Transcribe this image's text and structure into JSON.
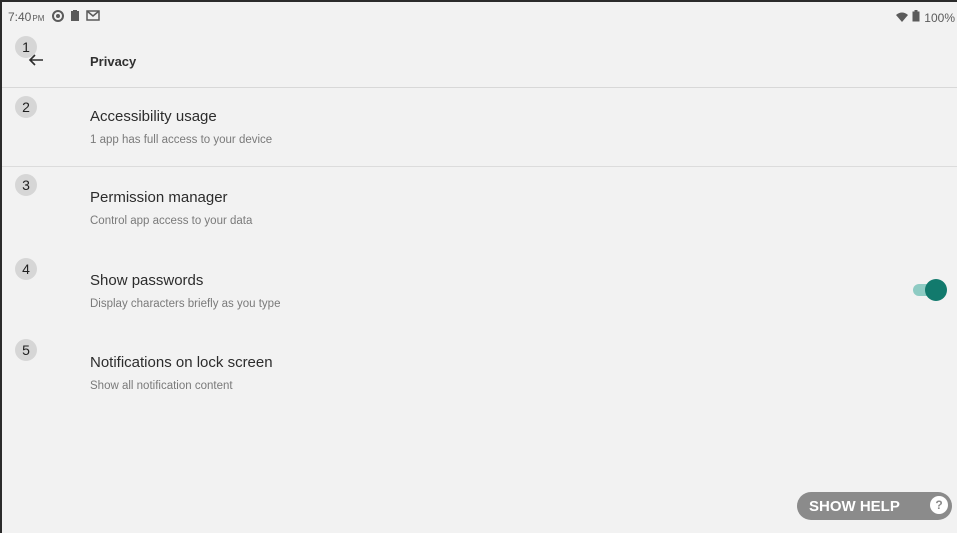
{
  "status_bar": {
    "time": "7:40",
    "ampm": "PM",
    "battery": "100%",
    "icons": [
      "circle-status-icon",
      "clipboard-icon",
      "gmail-icon",
      "wifi-icon",
      "battery-icon"
    ]
  },
  "app_bar": {
    "title": "Privacy",
    "back_icon": "arrow-left-icon"
  },
  "badges": [
    "1",
    "2",
    "3",
    "4",
    "5"
  ],
  "items": [
    {
      "title": "Accessibility usage",
      "subtitle": "1 app has full access to your device"
    },
    {
      "title": "Permission manager",
      "subtitle": "Control app access to your data"
    },
    {
      "title": "Show passwords",
      "subtitle": "Display characters briefly as you type",
      "toggle_on": true
    },
    {
      "title": "Notifications on lock screen",
      "subtitle": "Show all notification content"
    }
  ],
  "help": {
    "label": "SHOW HELP",
    "icon_glyph": "?"
  },
  "colors": {
    "accent": "#127a6d",
    "accent_track": "#8ecbc3",
    "background": "#f2f2f2",
    "help_pill": "#8b8b8b"
  }
}
